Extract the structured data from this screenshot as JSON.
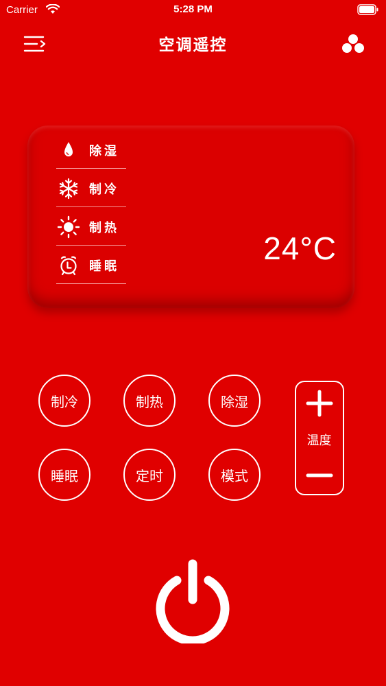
{
  "status_bar": {
    "carrier": "Carrier",
    "time": "5:28 PM",
    "icons": [
      "wifi-icon",
      "battery-icon"
    ]
  },
  "nav": {
    "title": "空调遥控",
    "menu_icon": "menu-icon",
    "right_icon": "three-circles-icon"
  },
  "display": {
    "modes": [
      {
        "icon": "droplet-icon",
        "label": "除湿"
      },
      {
        "icon": "snowflake-icon",
        "label": "制冷"
      },
      {
        "icon": "sun-icon",
        "label": "制热"
      },
      {
        "icon": "alarm-clock-icon",
        "label": "睡眠"
      }
    ],
    "temperature": "24°C"
  },
  "controls": {
    "buttons": [
      "制冷",
      "制热",
      "除湿",
      "睡眠",
      "定时",
      "模式"
    ],
    "temp_label": "温度",
    "temp_up_icon": "plus-icon",
    "temp_down_icon": "minus-icon",
    "power_icon": "power-icon"
  },
  "colors": {
    "background": "#e00000",
    "foreground": "#ffffff"
  }
}
